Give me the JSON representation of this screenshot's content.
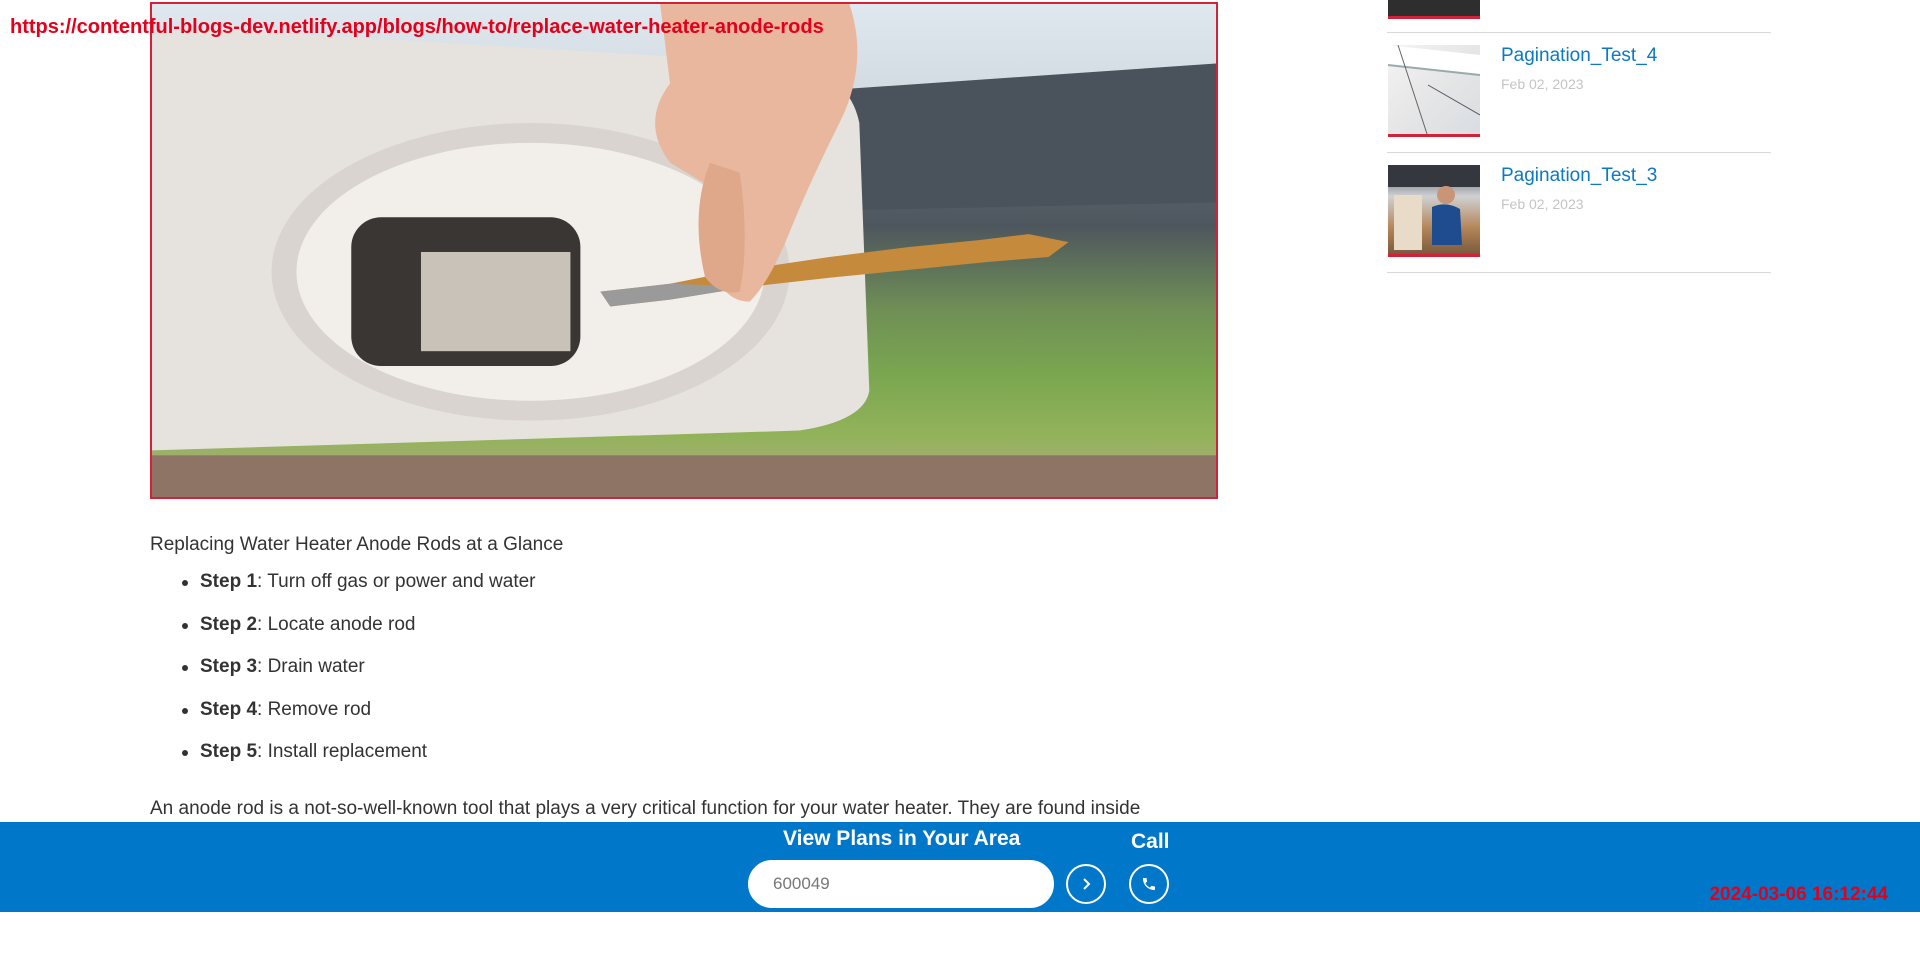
{
  "overlay": {
    "url": "https://contentful-blogs-dev.netlify.app/blogs/how-to/replace-water-heater-anode-rods",
    "timestamp": "2024-03-06 16:12:44"
  },
  "article": {
    "glance_title": "Replacing Water Heater Anode Rods at a Glance",
    "steps": [
      {
        "label": "Step 1",
        "text": ": Turn off gas or power and water"
      },
      {
        "label": "Step 2",
        "text": ": Locate anode rod"
      },
      {
        "label": "Step 3",
        "text": ": Drain water"
      },
      {
        "label": "Step 4",
        "text": ": Remove rod"
      },
      {
        "label": "Step 5",
        "text": ": Install replacement"
      }
    ],
    "intro": "An anode rod is a not-so-well-known tool that plays a very critical function for your water heater. They are found inside"
  },
  "sidebar": {
    "items": [
      {
        "title": "Pagination_Test_4",
        "date": "Feb 02, 2023"
      },
      {
        "title": "Pagination_Test_3",
        "date": "Feb 02, 2023"
      }
    ]
  },
  "bottom_bar": {
    "plans_label": "View Plans in Your Area",
    "zip_value": "600049",
    "call_label": "Call"
  },
  "colors": {
    "brand_blue": "#0077c8",
    "link_blue": "#0c79c1",
    "accent_red": "#d3213a"
  }
}
